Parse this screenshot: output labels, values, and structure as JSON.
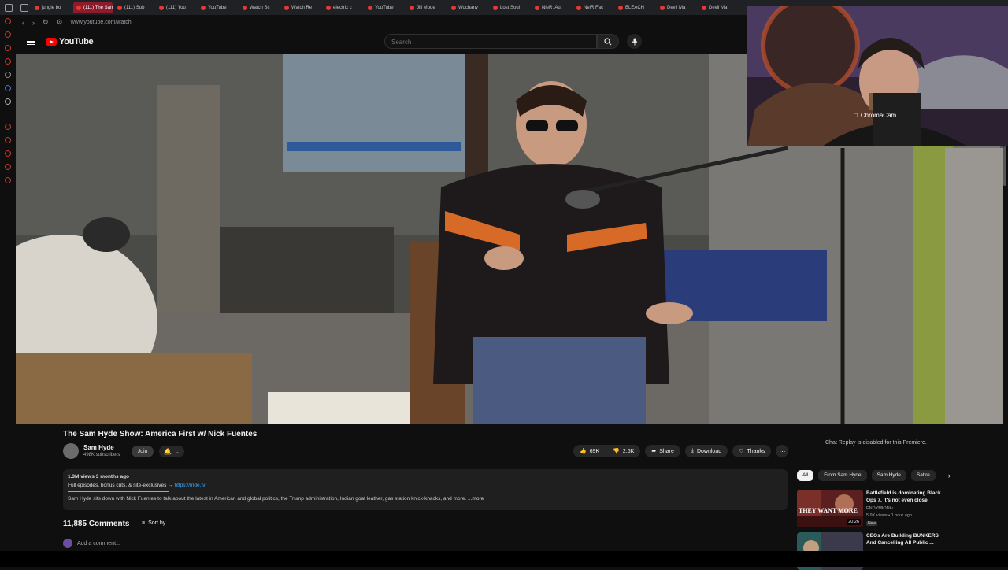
{
  "browser": {
    "tabs": [
      "jungle bo",
      "(111) The Sam",
      "(111) Sub",
      "(111) You",
      "YouTube",
      "Watch Sc",
      "Watch Re",
      "electric c",
      "YouTube",
      "Jill Mode",
      "Wochany",
      "Lost Soul",
      "NieR: Aut",
      "NeiR Fac",
      "BLEACH",
      "Devil Ma",
      "Devil Ma"
    ],
    "active_tab_index": 1,
    "url": "www.youtube.com/watch"
  },
  "youtube": {
    "logo_text": "YouTube",
    "search_placeholder": "Search"
  },
  "webcam": {
    "label": "ChromaCam"
  },
  "video": {
    "title": "The Sam Hyde Show: America First w/ Nick Fuentes",
    "channel_name": "Sam Hyde",
    "subscribers": "498K subscribers",
    "join_label": "Join",
    "likes": "69K",
    "dislikes": "2.6K",
    "share_label": "Share",
    "download_label": "Download",
    "thanks_label": "Thanks",
    "more_label": "⋯"
  },
  "description": {
    "meta": "1.3M views  3 months ago",
    "line1_text": "Full episodes, bonus cuts, & site-exclusives → ",
    "line1_link": "https://mde.tv",
    "body": "Sam Hyde sits down with Nick Fuentes to talk about the latest in American and global politics, the Trump administration, Indian goat leather, gas station knick-knacks, and more.",
    "more": "...more"
  },
  "comments": {
    "count": "11,885 Comments",
    "sort_label": "Sort by",
    "add_placeholder": "Add a comment..."
  },
  "sidebar": {
    "chat_note": "Chat Replay is disabled for this Premiere.",
    "chips": [
      "All",
      "From Sam Hyde",
      "Sam Hyde",
      "Satire"
    ],
    "recs": [
      {
        "title": "Battlefield is dominating Black Ops 7, it's not even close",
        "channel": "ENDYMIONtv",
        "meta": "5.9K views • 1 hour ago",
        "badge": "New",
        "duration": "20:26",
        "thumb_text": "THEY WANT MORE"
      },
      {
        "title": "CEOs Are Building BUNKERS And Cancelling All Public ...",
        "channel": "",
        "meta": "",
        "badge": "",
        "duration": "",
        "thumb_text": ""
      }
    ]
  },
  "colors": {
    "yt_red": "#ff0000",
    "active_tab": "#8a1c2c",
    "link": "#3ea6ff"
  }
}
